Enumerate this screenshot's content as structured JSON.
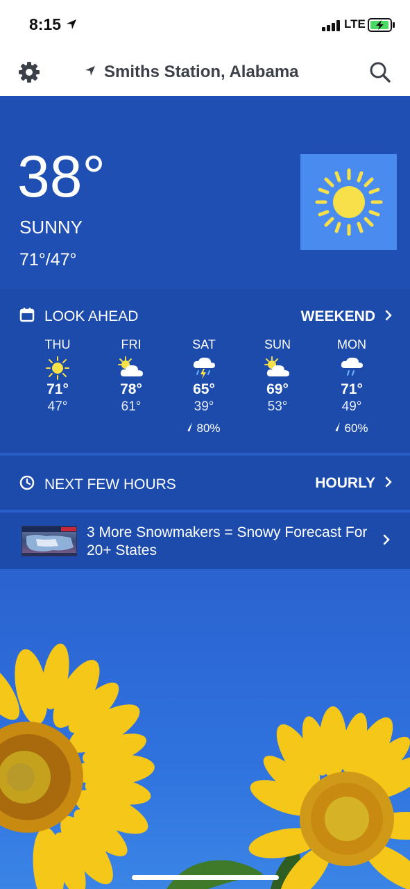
{
  "status": {
    "time": "8:15",
    "network": "LTE"
  },
  "header": {
    "location": "Smiths Station, Alabama"
  },
  "current": {
    "temp": "38°",
    "condition": "SUNNY",
    "hilo": "71°/47°"
  },
  "lookahead": {
    "title": "LOOK AHEAD",
    "link": "WEEKEND",
    "days": [
      {
        "name": "THU",
        "icon": "sunny-icon",
        "hi": "71°",
        "lo": "47°",
        "precip": ""
      },
      {
        "name": "FRI",
        "icon": "partly-cloudy-icon",
        "hi": "78°",
        "lo": "61°",
        "precip": ""
      },
      {
        "name": "SAT",
        "icon": "thunderstorm-icon",
        "hi": "65°",
        "lo": "39°",
        "precip": "80%"
      },
      {
        "name": "SUN",
        "icon": "partly-cloudy-icon",
        "hi": "69°",
        "lo": "53°",
        "precip": ""
      },
      {
        "name": "MON",
        "icon": "rain-icon",
        "hi": "71°",
        "lo": "49°",
        "precip": "60%"
      }
    ]
  },
  "hours": {
    "title": "NEXT FEW HOURS",
    "link": "HOURLY"
  },
  "news": {
    "headline": "3 More Snowmakers = Snowy Forecast For 20+ States"
  },
  "colors": {
    "hero_bg": "#1f4fb3",
    "section_bg": "#1c4bab",
    "icon_box": "#4a8bf0",
    "sun_yellow": "#f7e04a"
  }
}
